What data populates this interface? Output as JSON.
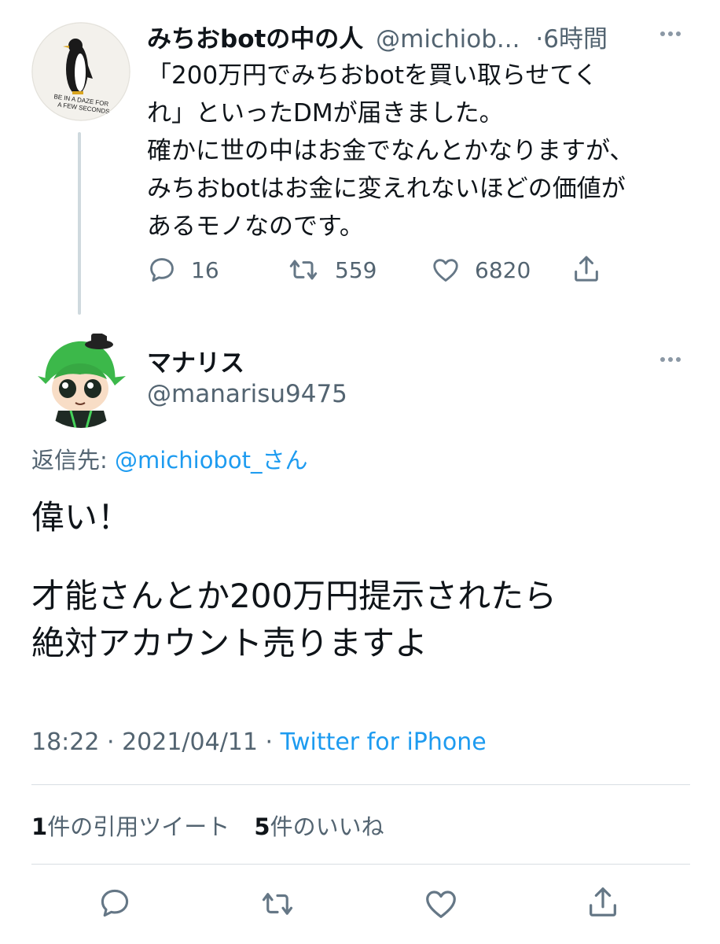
{
  "parent_tweet": {
    "display_name": "みちおbotの中の人",
    "handle": "@michiob...",
    "time_sep": "·",
    "relative_time": "6時間",
    "avatar_text": [
      "BE IN A DAZE FOR",
      "A FEW SECONDS"
    ],
    "text_lines": [
      "「200万円でみちおbotを買い取らせてく",
      "れ」といったDMが届きました。",
      "確かに世の中はお金でなんとかなりますが、",
      "みちおbotはお金に変えれないほどの価値が",
      "あるモノなのです。"
    ],
    "stats": {
      "replies": "16",
      "retweets": "559",
      "likes": "6820"
    }
  },
  "main_tweet": {
    "display_name": "マナリス",
    "handle": "@manarisu9475",
    "reply_label": "返信先: ",
    "reply_to": "@michiobot_さん",
    "text_lines": [
      "偉い！",
      "才能さんとか200万円提示されたら",
      "絶対アカウント売りますよ"
    ],
    "timestamp": "18:22 · 2021/04/11 · ",
    "source": "Twitter for iPhone",
    "quote_count": "1",
    "quote_label": "件の引用ツイート",
    "like_count": "5",
    "like_label": "件のいいね"
  },
  "colors": {
    "accent": "#1d9bf0",
    "secondary_text": "#536471",
    "icon": "#657786"
  }
}
